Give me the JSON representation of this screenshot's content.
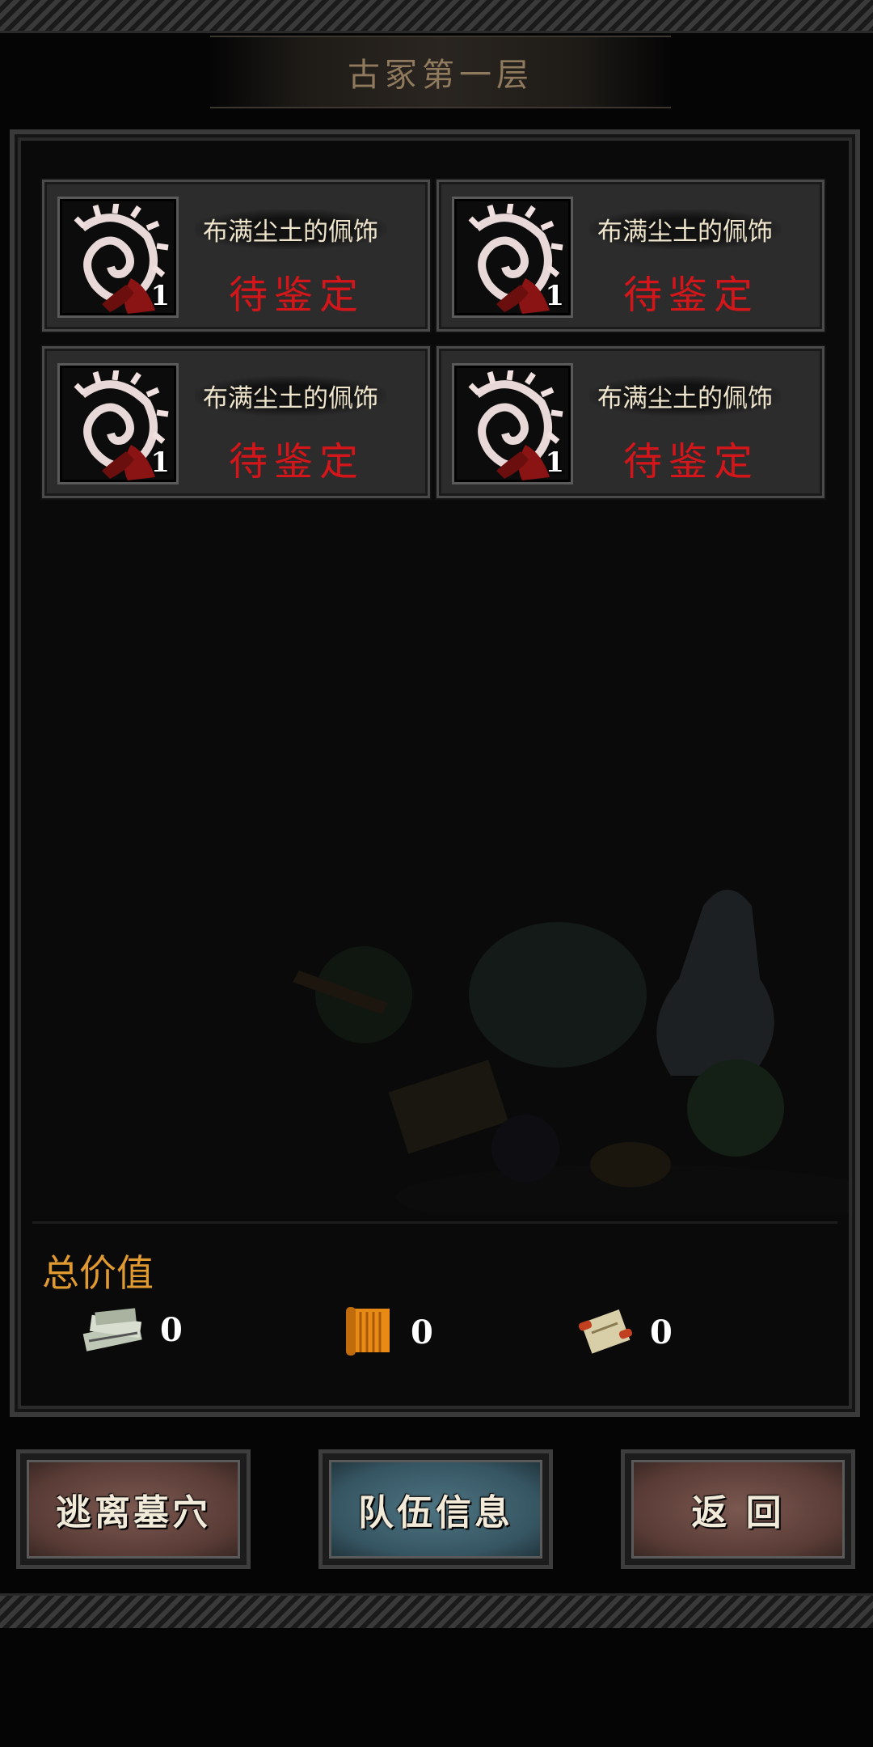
{
  "header": {
    "title": "古冢第一层"
  },
  "items": [
    {
      "name": "布满尘土的佩饰",
      "status": "待鉴定",
      "quantity": "1",
      "icon": "shell-amulet-icon"
    },
    {
      "name": "布满尘土的佩饰",
      "status": "待鉴定",
      "quantity": "1",
      "icon": "shell-amulet-icon"
    },
    {
      "name": "布满尘土的佩饰",
      "status": "待鉴定",
      "quantity": "1",
      "icon": "shell-amulet-icon"
    },
    {
      "name": "布满尘土的佩饰",
      "status": "待鉴定",
      "quantity": "1",
      "icon": "shell-amulet-icon"
    }
  ],
  "summary": {
    "label": "总价值",
    "currencies": [
      {
        "icon": "money-pile-icon",
        "value": "0"
      },
      {
        "icon": "orange-scroll-icon",
        "value": "0"
      },
      {
        "icon": "map-scroll-icon",
        "value": "0"
      }
    ]
  },
  "buttons": {
    "escape": "逃离墓穴",
    "team_info": "队伍信息",
    "back": "返 回"
  },
  "colors": {
    "status_red": "#d4161a",
    "label_orange": "#e09a30",
    "title_tan": "#8f7a5e",
    "escape_button": "#6b4a42",
    "team_button": "#3f6170",
    "back_button": "#6b4a42"
  }
}
